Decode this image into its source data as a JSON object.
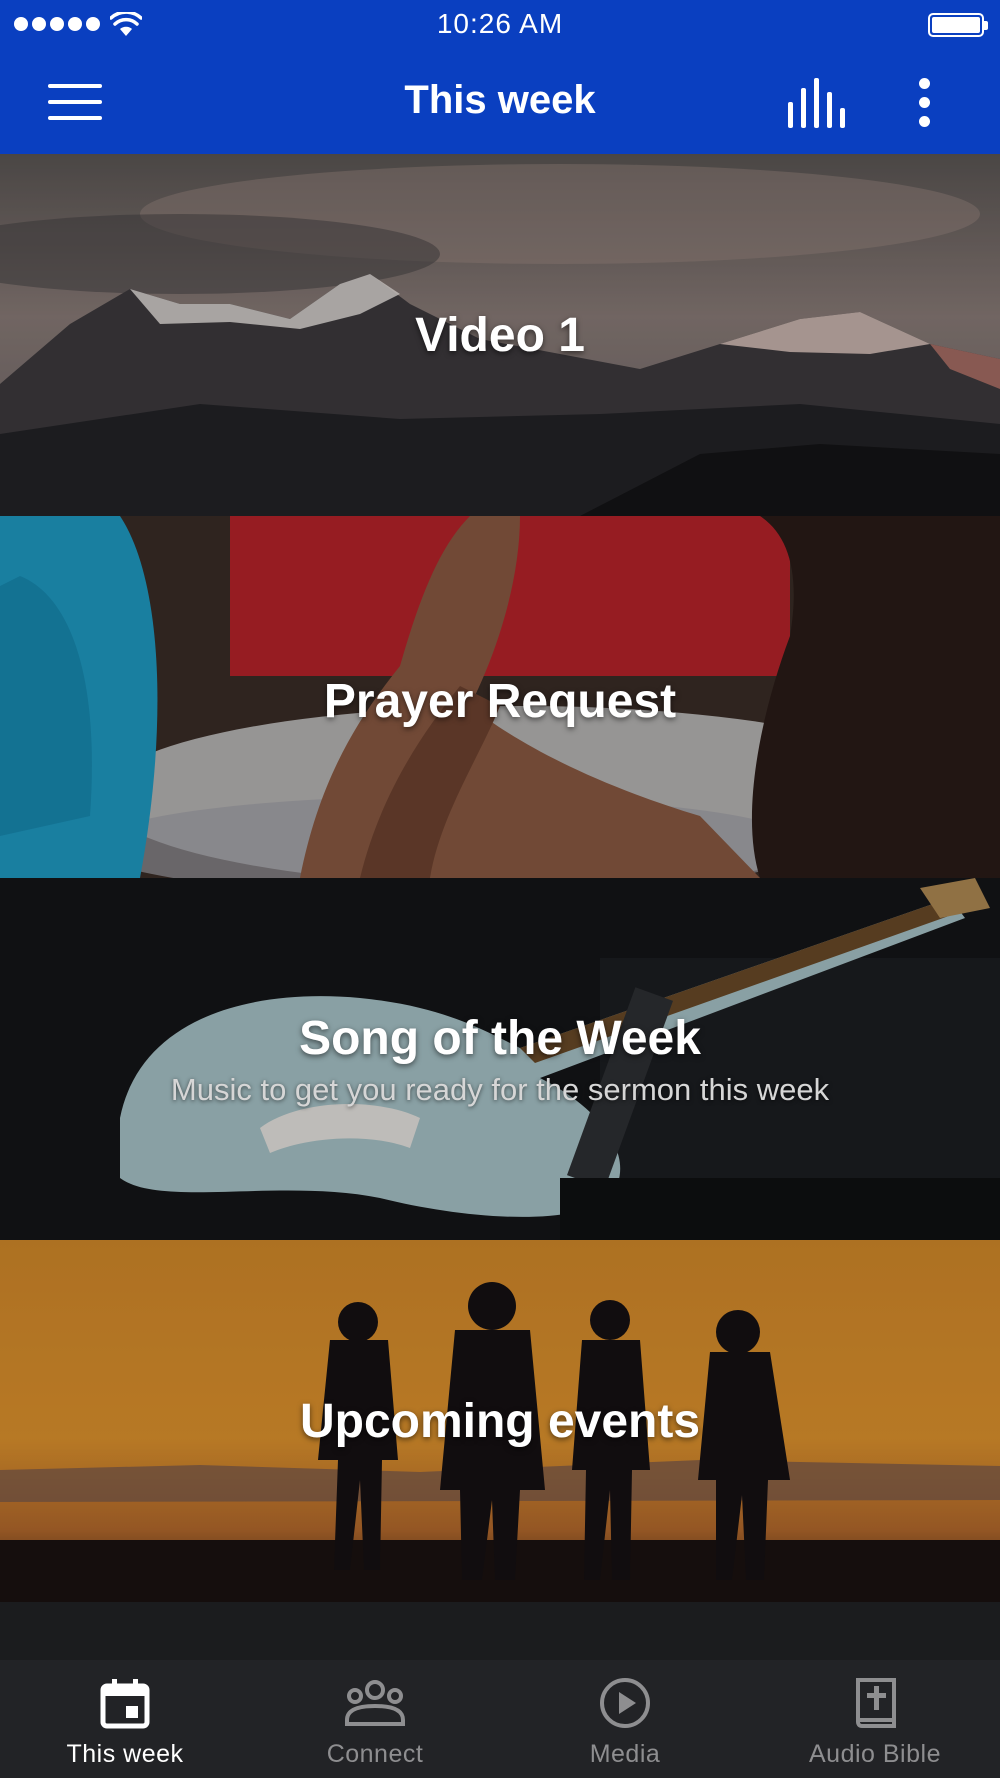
{
  "status_bar": {
    "time": "10:26 AM"
  },
  "app_bar": {
    "title": "This week"
  },
  "cards": [
    {
      "title": "Video 1",
      "subtitle": ""
    },
    {
      "title": "Prayer Request",
      "subtitle": ""
    },
    {
      "title": "Song of the Week",
      "subtitle": "Music to get you ready for the sermon this week"
    },
    {
      "title": "Upcoming events",
      "subtitle": ""
    }
  ],
  "bottom_nav": {
    "items": [
      {
        "label": "This week",
        "icon": "calendar-icon",
        "active": true
      },
      {
        "label": "Connect",
        "icon": "group-icon",
        "active": false
      },
      {
        "label": "Media",
        "icon": "play-circle-icon",
        "active": false
      },
      {
        "label": "Audio Bible",
        "icon": "bible-icon",
        "active": false
      }
    ]
  },
  "colors": {
    "primary": "#0a3fc0",
    "nav_background": "#222326",
    "nav_active": "#ffffff",
    "nav_inactive": "#8e8e90"
  }
}
